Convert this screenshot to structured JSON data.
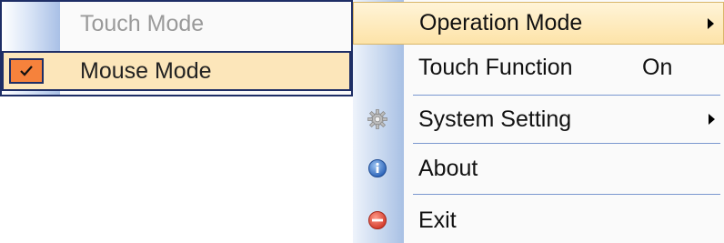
{
  "submenu": {
    "items": [
      {
        "label": "Touch Mode",
        "state": "disabled"
      },
      {
        "label": "Mouse Mode",
        "state": "checked"
      }
    ]
  },
  "menu": {
    "items": [
      {
        "label": "Operation Mode",
        "has_submenu": true,
        "highlighted": true
      },
      {
        "label": "Touch Function",
        "value": "On"
      },
      {
        "label": "System Setting",
        "icon": "gear-icon",
        "has_submenu": true
      },
      {
        "label": "About",
        "icon": "info-icon"
      },
      {
        "label": "Exit",
        "icon": "exit-icon"
      }
    ]
  },
  "colors": {
    "highlight": "#fde3a8",
    "selected": "#fce6ba",
    "check_box": "#f6823c",
    "border": "#1e2e66",
    "separator": "#7a97cf"
  }
}
